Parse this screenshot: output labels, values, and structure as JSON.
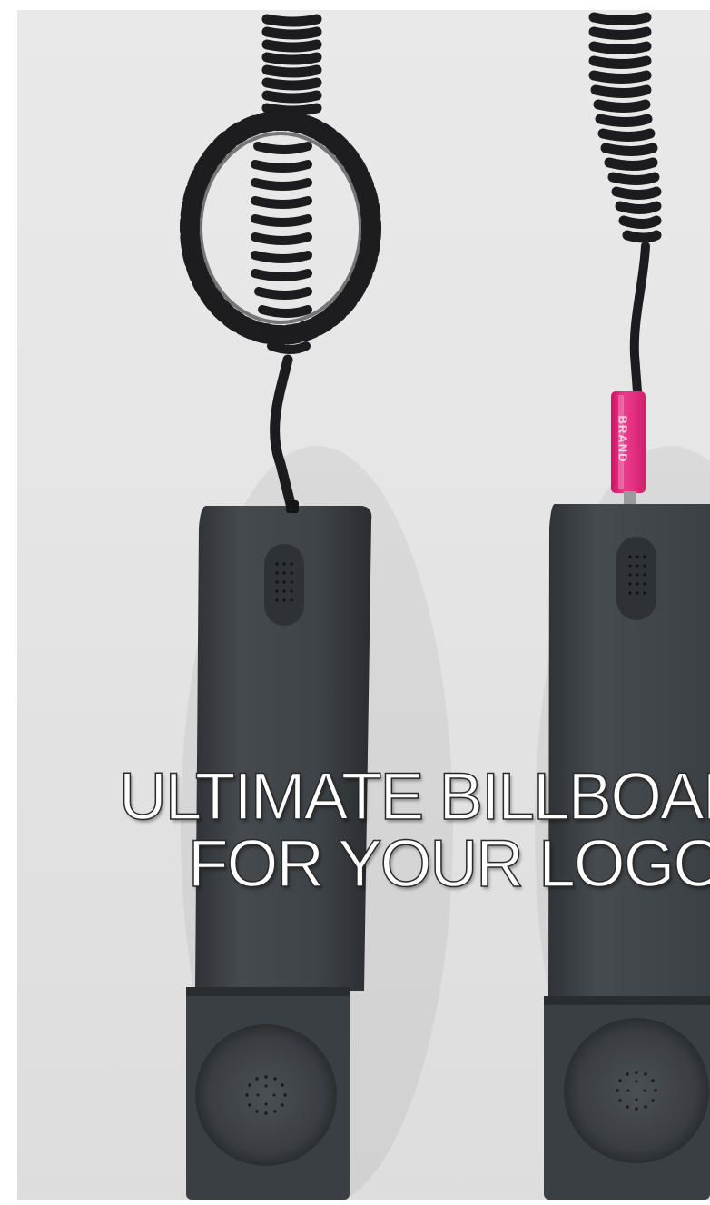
{
  "ad": {
    "headline_line1": "ULTIMATE BILLBOARD",
    "headline_line2": "FOR YOUR LOGO",
    "brand_tag_text": "BRAND"
  },
  "colors": {
    "background": "#e6e6e6",
    "handset": "#3f4448",
    "cord": "#1c1c1e",
    "brand_tag": "#e8277f",
    "headline_fill": "#ffffff",
    "headline_stroke": "#2a2a2a"
  },
  "icons": {
    "left_cord": "coiled-cord-knotted-icon",
    "right_cord": "coiled-cord-icon",
    "left_handset": "telephone-handset-icon",
    "right_handset": "telephone-handset-icon"
  }
}
